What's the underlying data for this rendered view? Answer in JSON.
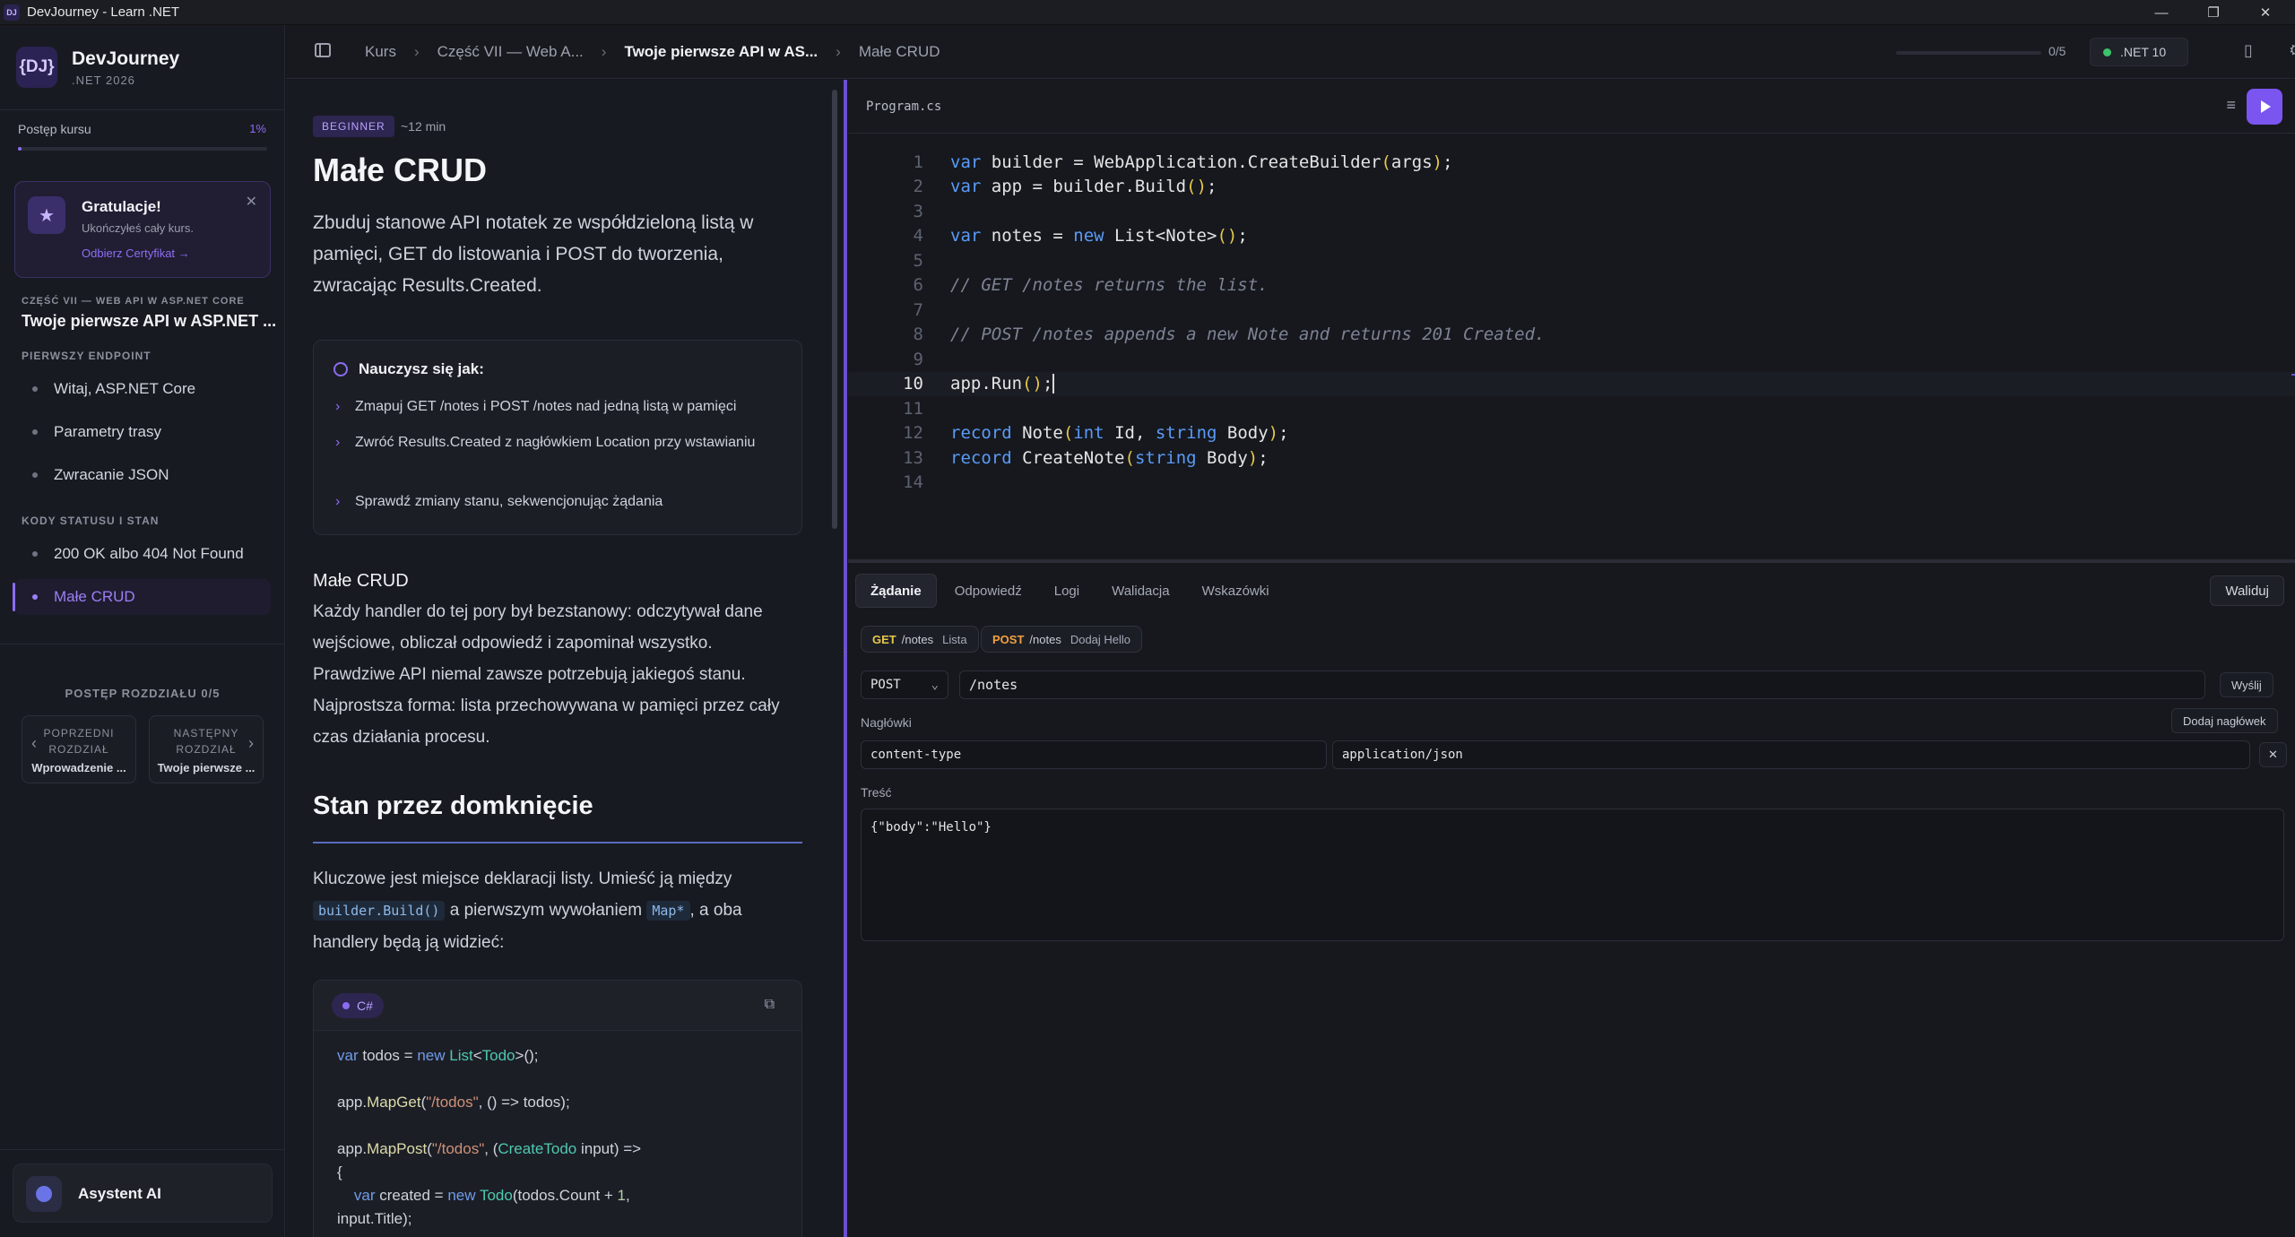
{
  "window": {
    "title": "DevJourney - Learn .NET"
  },
  "brand": {
    "logo": "{DJ}",
    "name": "DevJourney",
    "sub": ".NET 2026"
  },
  "course_progress": {
    "label": "Postęp kursu",
    "percent": "1%",
    "value": 0.01
  },
  "congrats": {
    "title": "Gratulacje!",
    "subtitle": "Ukończyłeś cały kurs.",
    "link": "Odbierz Certyfikat →"
  },
  "part": {
    "label": "CZĘŚĆ VII — WEB API W ASP.NET CORE",
    "title": "Twoje pierwsze API w ASP.NET ..."
  },
  "sections": [
    {
      "label": "PIERWSZY ENDPOINT",
      "items": [
        "Witaj, ASP.NET Core",
        "Parametry trasy",
        "Zwracanie JSON"
      ]
    },
    {
      "label": "KODY STATUSU I STAN",
      "items": [
        "200 OK albo 404 Not Found",
        "Małe CRUD"
      ]
    }
  ],
  "chapter_progress": "POSTĘP ROZDZIAŁU 0/5",
  "prev_chapter": {
    "label_line1": "POPRZEDNI",
    "label_line2": "ROZDZIAŁ",
    "title": "Wprowadzenie ..."
  },
  "next_chapter": {
    "label_line1": "NASTĘPNY",
    "label_line2": "ROZDZIAŁ",
    "title": "Twoje pierwsze ..."
  },
  "assistant": {
    "label": "Asystent AI"
  },
  "breadcrumb": [
    "Kurs",
    "Część VII — Web A...",
    "Twoje pierwsze API w AS...",
    "Małe CRUD"
  ],
  "lesson_progress": {
    "count": "0/5",
    "value": 0
  },
  "runtime": {
    "label": ".NET 10",
    "status_color": "#3cc36b"
  },
  "lesson": {
    "level": "BEGINNER",
    "read_time": "~12 min",
    "title": "Małe CRUD",
    "intro": "Zbuduj stanowe API notatek ze współdzieloną listą w pamięci, GET do listowania i POST do tworzenia, zwracając Results.Created.",
    "learn_title": "Nauczysz się jak:",
    "learn_items": [
      "Zmapuj GET /notes i POST /notes nad jedną listą w pamięci",
      "Zwróć Results.Created z nagłówkiem Location przy wstawianiu",
      "Sprawdź zmiany stanu, sekwencjonując żądania"
    ],
    "sub_heading": "Małe CRUD",
    "paragraph": "Każdy handler do tej pory był bezstanowy: odczytywał dane wejściowe, obliczał odpowiedź i zapominał wszystko. Prawdziwe API niemal zawsze potrzebują jakiegoś stanu. Najprostsza forma: lista przechowywana w pamięci przez cały czas działania procesu.",
    "h2": "Stan przez domknięcie",
    "p2_before": "Kluczowe jest miejsce deklaracji listy. Umieść ją między",
    "p2_code1": "builder.Build()",
    "p2_middle": "a pierwszym wywołaniem",
    "p2_code2": "Map*",
    "p2_after": ", a oba handlery będą ją widzieć:",
    "code_lang": "C#",
    "code_lines": [
      "var todos = new List<Todo>();",
      "",
      "app.MapGet(\"/todos\", () => todos);",
      "",
      "app.MapPost(\"/todos\", (CreateTodo input) =>",
      "{",
      "    var created = new Todo(todos.Count + 1,",
      "input.Title);"
    ]
  },
  "editor": {
    "file": "Program.cs",
    "lines": [
      "var builder = WebApplication.CreateBuilder(args);",
      "var app = builder.Build();",
      "",
      "var notes = new List<Note>();",
      "",
      "// GET /notes returns the list.",
      "",
      "// POST /notes appends a new Note and returns 201 Created.",
      "",
      "app.Run();",
      "",
      "record Note(int Id, string Body);",
      "record CreateNote(string Body);",
      ""
    ],
    "current_line": 10
  },
  "request": {
    "tabs": [
      "Żądanie",
      "Odpowiedź",
      "Logi",
      "Walidacja",
      "Wskazówki"
    ],
    "validate": "Waliduj",
    "presets": [
      {
        "method": "GET",
        "path": "/notes",
        "label": "Lista",
        "color": "#e6c84a"
      },
      {
        "method": "POST",
        "path": "/notes",
        "label": "Dodaj Hello",
        "color": "#f0a040"
      }
    ],
    "method": "POST",
    "url": "/notes",
    "send": "Wyślij",
    "headers_label": "Nagłówki",
    "add_header": "Dodaj nagłówek",
    "header_key": "content-type",
    "header_value": "application/json",
    "body_label": "Treść",
    "body": "{\"body\":\"Hello\"}"
  }
}
